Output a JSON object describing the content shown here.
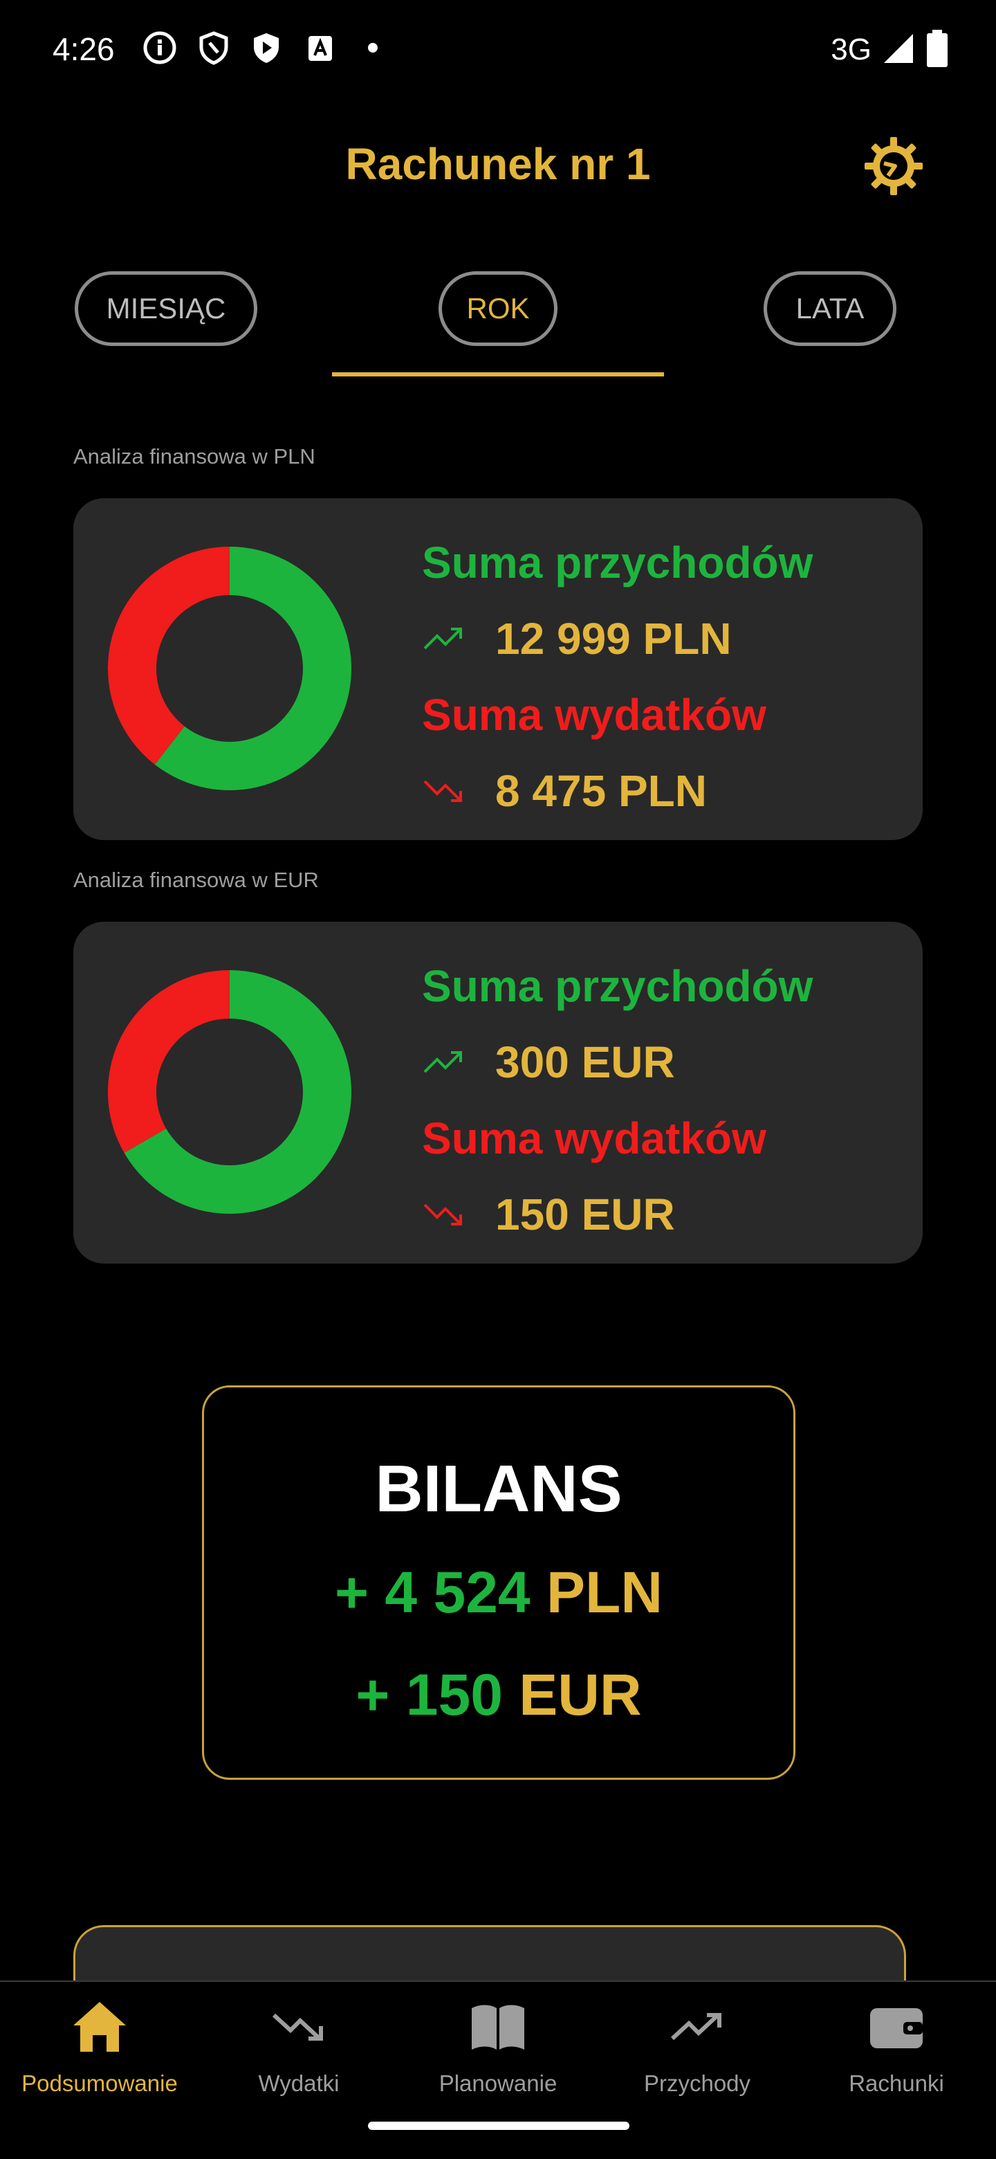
{
  "status_bar": {
    "time": "4:26",
    "network": "3G",
    "icons": [
      "info-icon",
      "shield-icon",
      "play-protect-icon",
      "accessibility-icon",
      "dot-icon",
      "signal-icon",
      "battery-icon"
    ]
  },
  "header": {
    "title": "Rachunek nr 1",
    "settings_icon": "gear-icon"
  },
  "tabs": [
    {
      "label": "MIESIĄC",
      "active": false
    },
    {
      "label": "ROK",
      "active": true
    },
    {
      "label": "LATA",
      "active": false
    }
  ],
  "sections": [
    {
      "label": "Analiza finansowa w PLN",
      "income_heading": "Suma przychodów",
      "income_amount": "12 999 PLN",
      "expense_heading": "Suma wydatków",
      "expense_amount": "8 475 PLN",
      "donut": {
        "income": 12999,
        "expense": 8475
      }
    },
    {
      "label": "Analiza finansowa w EUR",
      "income_heading": "Suma przychodów",
      "income_amount": "300 EUR",
      "expense_heading": "Suma wydatków",
      "expense_amount": "150 EUR",
      "donut": {
        "income": 300,
        "expense": 150
      }
    }
  ],
  "bilans": {
    "title": "BILANS",
    "lines": [
      {
        "sign": "+",
        "value": "4 524",
        "currency": "PLN"
      },
      {
        "sign": "+",
        "value": "150",
        "currency": "EUR"
      }
    ]
  },
  "bottom_nav": [
    {
      "label": "Podsumowanie",
      "icon": "home-icon",
      "active": true
    },
    {
      "label": "Wydatki",
      "icon": "trending-down-icon",
      "active": false
    },
    {
      "label": "Planowanie",
      "icon": "book-icon",
      "active": false
    },
    {
      "label": "Przychody",
      "icon": "trending-up-icon",
      "active": false
    },
    {
      "label": "Rachunki",
      "icon": "wallet-icon",
      "active": false
    }
  ],
  "colors": {
    "accent": "#E3B53C",
    "income": "#1DB43E",
    "expense": "#F11C1C",
    "card": "#292929",
    "background": "#000000"
  }
}
